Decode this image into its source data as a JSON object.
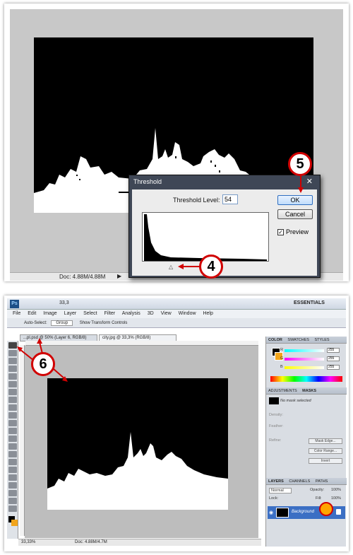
{
  "top_panel": {
    "status_doc": "Doc: 4.88M/4.88M",
    "status_arrow": "▶",
    "dialog": {
      "title": "Threshold",
      "close": "✕",
      "threshold_label": "Threshold Level:",
      "threshold_value": "54",
      "ok_label": "OK",
      "cancel_label": "Cancel",
      "preview_label": "Preview",
      "preview_checked": "✓"
    },
    "callout_4": "4",
    "callout_5": "5"
  },
  "bottom_panel": {
    "zoom": "33,3",
    "workspace": "ESSENTIALS",
    "menu": [
      "File",
      "Edit",
      "Image",
      "Layer",
      "Select",
      "Filter",
      "Analysis",
      "3D",
      "View",
      "Window",
      "Help"
    ],
    "options": {
      "auto_select": "Auto-Select:",
      "group": "Group",
      "show_transform": "Show Transform Controls"
    },
    "tabs": [
      {
        "label": "...pl.psd @ 50% (Layer 6, RGB/8)"
      },
      {
        "label": "city.jpg @ 33,3% (RGB/8)"
      }
    ],
    "status_zoom": "33,33%",
    "status_doc": "Doc: 4.88M/4.7M",
    "color_panel": {
      "tabs": [
        "COLOR",
        "SWATCHES",
        "STYLES"
      ],
      "r_label": "R",
      "g_label": "G",
      "b_label": "B",
      "r_val": "255",
      "g_val": "255",
      "b_val": "255"
    },
    "masks_panel": {
      "tabs": [
        "ADJUSTMENTS",
        "MASKS"
      ],
      "no_mask": "No mask selected",
      "density": "Density:",
      "feather": "Feather:",
      "refine": "Refine:",
      "mask_edge": "Mask Edge...",
      "color_range": "Color Range...",
      "invert": "Invert"
    },
    "layers_panel": {
      "tabs": [
        "LAYERS",
        "CHANNELS",
        "PATHS"
      ],
      "blend": "Normal",
      "opacity_label": "Opacity:",
      "opacity": "100%",
      "lock_label": "Lock:",
      "fill_label": "Fill:",
      "fill": "100%",
      "layer_name": "Background"
    },
    "callout_6": "6"
  },
  "colors": {
    "callout_red": "#d10000",
    "highlight_orange": "#ffa500",
    "dialog_frame": "#3f4756",
    "selected_layer": "#3b6fc4"
  }
}
